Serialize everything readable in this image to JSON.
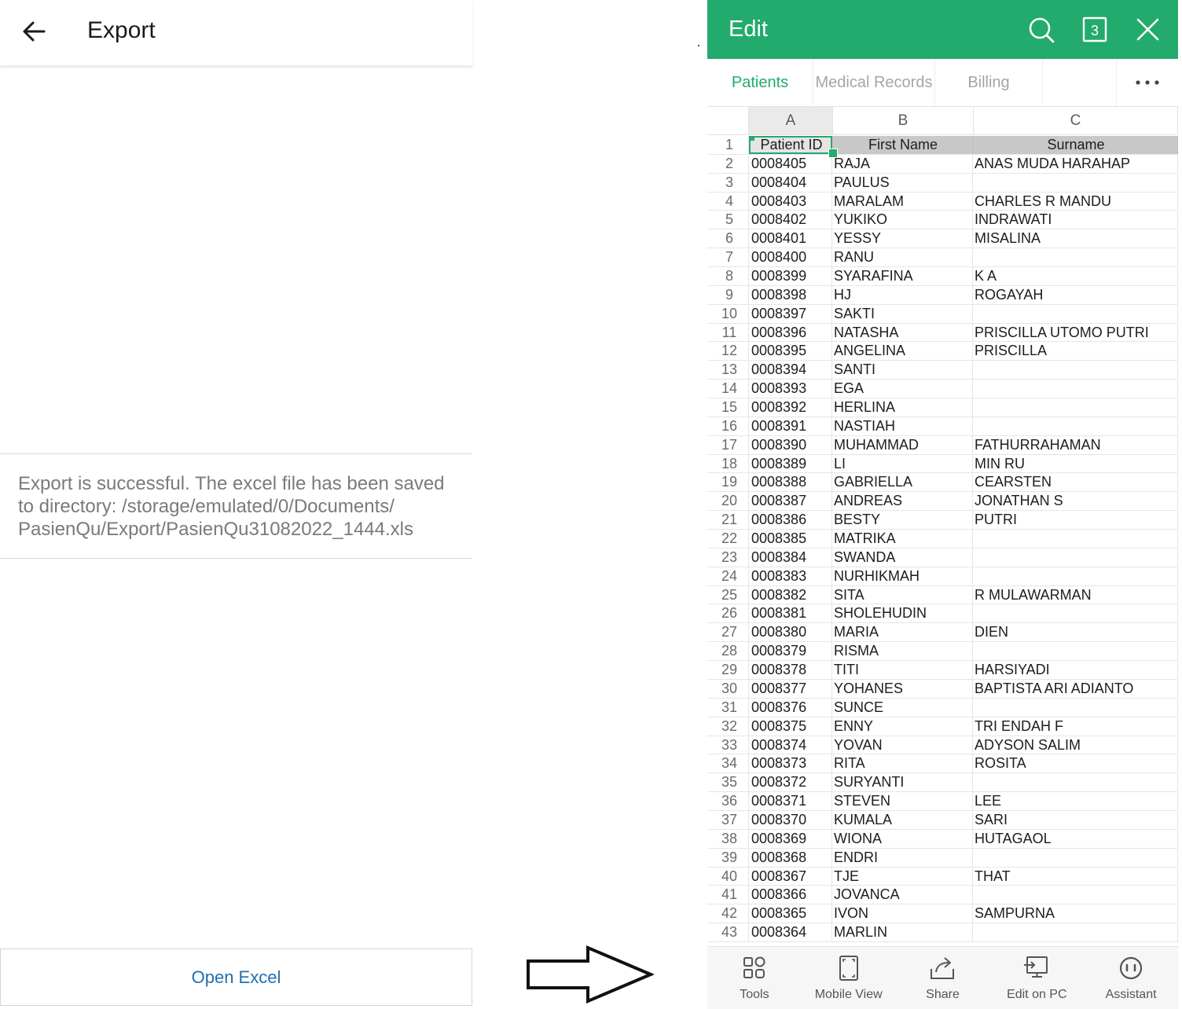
{
  "export": {
    "title": "Export",
    "message": "Export is successful. The excel file has been saved\nto directory:  /storage/emulated/0/Documents/\nPasienQu/Export/PasienQu31082022_1444.xls",
    "open_button": "Open Excel"
  },
  "app": {
    "title": "Edit",
    "tab_count": "3",
    "accent_color": "#22ab6c",
    "sheet_tabs": [
      "Patients",
      "Medical Records",
      "Billing"
    ],
    "active_tab": "Patients"
  },
  "grid": {
    "columns": [
      "A",
      "B",
      "C"
    ],
    "header_row": {
      "num": "1",
      "a": "Patient ID",
      "b": "First Name",
      "c": "Surname"
    },
    "rows": [
      {
        "num": "2",
        "a": "0008405",
        "b": "RAJA",
        "c": "ANAS MUDA HARAHAP"
      },
      {
        "num": "3",
        "a": "0008404",
        "b": "PAULUS",
        "c": ""
      },
      {
        "num": "4",
        "a": "0008403",
        "b": "MARALAM",
        "c": "CHARLES R MANDU"
      },
      {
        "num": "5",
        "a": "0008402",
        "b": "YUKIKO",
        "c": "INDRAWATI"
      },
      {
        "num": "6",
        "a": "0008401",
        "b": "YESSY",
        "c": "MISALINA"
      },
      {
        "num": "7",
        "a": "0008400",
        "b": "RANU",
        "c": ""
      },
      {
        "num": "8",
        "a": "0008399",
        "b": "SYARAFINA",
        "c": "K A"
      },
      {
        "num": "9",
        "a": "0008398",
        "b": "HJ",
        "c": "ROGAYAH"
      },
      {
        "num": "10",
        "a": "0008397",
        "b": "SAKTI",
        "c": ""
      },
      {
        "num": "11",
        "a": "0008396",
        "b": "NATASHA",
        "c": "PRISCILLA UTOMO PUTRI"
      },
      {
        "num": "12",
        "a": "0008395",
        "b": "ANGELINA",
        "c": "PRISCILLA"
      },
      {
        "num": "13",
        "a": "0008394",
        "b": "SANTI",
        "c": ""
      },
      {
        "num": "14",
        "a": "0008393",
        "b": "EGA",
        "c": ""
      },
      {
        "num": "15",
        "a": "0008392",
        "b": "HERLINA",
        "c": ""
      },
      {
        "num": "16",
        "a": "0008391",
        "b": "NASTIAH",
        "c": ""
      },
      {
        "num": "17",
        "a": "0008390",
        "b": "MUHAMMAD",
        "c": "FATHURRAHAMAN"
      },
      {
        "num": "18",
        "a": "0008389",
        "b": "LI",
        "c": "MIN RU"
      },
      {
        "num": "19",
        "a": "0008388",
        "b": "GABRIELLA",
        "c": "CEARSTEN"
      },
      {
        "num": "20",
        "a": "0008387",
        "b": "ANDREAS",
        "c": "JONATHAN S"
      },
      {
        "num": "21",
        "a": "0008386",
        "b": "BESTY",
        "c": "PUTRI"
      },
      {
        "num": "22",
        "a": "0008385",
        "b": "MATRIKA",
        "c": ""
      },
      {
        "num": "23",
        "a": "0008384",
        "b": "SWANDA",
        "c": ""
      },
      {
        "num": "24",
        "a": "0008383",
        "b": "NURHIKMAH",
        "c": ""
      },
      {
        "num": "25",
        "a": "0008382",
        "b": "SITA",
        "c": "R MULAWARMAN"
      },
      {
        "num": "26",
        "a": "0008381",
        "b": "SHOLEHUDIN",
        "c": ""
      },
      {
        "num": "27",
        "a": "0008380",
        "b": "MARIA",
        "c": "DIEN"
      },
      {
        "num": "28",
        "a": "0008379",
        "b": "RISMA",
        "c": ""
      },
      {
        "num": "29",
        "a": "0008378",
        "b": "TITI",
        "c": "HARSIYADI"
      },
      {
        "num": "30",
        "a": "0008377",
        "b": "YOHANES",
        "c": "BAPTISTA ARI ADIANTO"
      },
      {
        "num": "31",
        "a": "0008376",
        "b": "SUNCE",
        "c": ""
      },
      {
        "num": "32",
        "a": "0008375",
        "b": "ENNY",
        "c": "TRI ENDAH F"
      },
      {
        "num": "33",
        "a": "0008374",
        "b": "YOVAN",
        "c": "ADYSON SALIM"
      },
      {
        "num": "34",
        "a": "0008373",
        "b": "RITA",
        "c": "ROSITA"
      },
      {
        "num": "35",
        "a": "0008372",
        "b": "SURYANTI",
        "c": ""
      },
      {
        "num": "36",
        "a": "0008371",
        "b": "STEVEN",
        "c": "LEE"
      },
      {
        "num": "37",
        "a": "0008370",
        "b": "KUMALA",
        "c": "SARI"
      },
      {
        "num": "38",
        "a": "0008369",
        "b": "WIONA",
        "c": "HUTAGAOL"
      },
      {
        "num": "39",
        "a": "0008368",
        "b": "ENDRI",
        "c": ""
      },
      {
        "num": "40",
        "a": "0008367",
        "b": "TJE",
        "c": "THAT"
      },
      {
        "num": "41",
        "a": "0008366",
        "b": "JOVANCA",
        "c": ""
      },
      {
        "num": "42",
        "a": "0008365",
        "b": "IVON",
        "c": "SAMPURNA"
      },
      {
        "num": "43",
        "a": "0008364",
        "b": "MARLIN",
        "c": ""
      }
    ]
  },
  "toolbar": {
    "items": [
      {
        "label": "Tools",
        "icon": "tools-grid-icon"
      },
      {
        "label": "Mobile View",
        "icon": "mobile-view-icon"
      },
      {
        "label": "Share",
        "icon": "share-icon"
      },
      {
        "label": "Edit on PC",
        "icon": "edit-on-pc-icon"
      },
      {
        "label": "Assistant",
        "icon": "assistant-icon"
      }
    ]
  }
}
